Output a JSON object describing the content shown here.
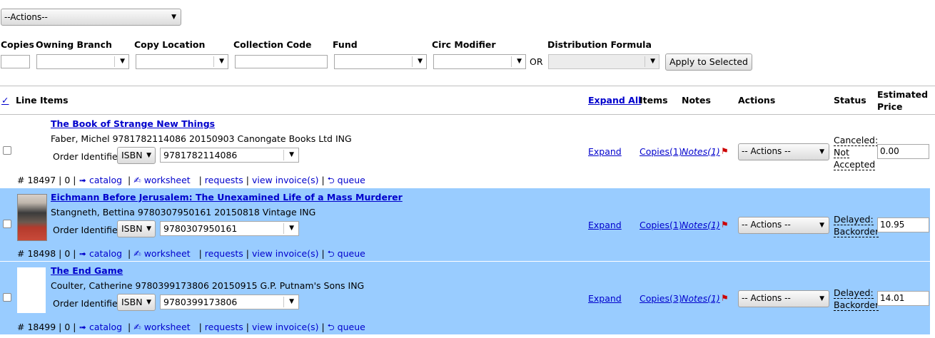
{
  "top": {
    "actions_select": "--Actions--"
  },
  "batch": {
    "copies_label": "Copies",
    "owning_branch_label": "Owning Branch",
    "copy_location_label": "Copy Location",
    "collection_code_label": "Collection Code",
    "fund_label": "Fund",
    "circ_modifier_label": "Circ Modifier",
    "or_text": "OR",
    "distribution_formula_label": "Distribution Formula",
    "apply_button": "Apply to Selected"
  },
  "header": {
    "check_mark": "✓",
    "line_items": "Line Items",
    "expand_all": "Expand All",
    "items": "Items",
    "notes": "Notes",
    "actions": "Actions",
    "status": "Status",
    "estimated": "Estimated",
    "price": "Price"
  },
  "colors": {
    "highlight_row": "#99ccff",
    "link": "#0000cc",
    "flag": "#cc0000"
  },
  "rows": [
    {
      "title": "The Book of Strange New Things",
      "meta": "Faber, Michel 9781782114086 20150903 Canongate Books Ltd ING",
      "order_identifier_label": "Order Identifier",
      "identifier_type": "ISBN",
      "identifier_value": "9781782114086",
      "id_text": "# 18497 | 0 |",
      "catalog": "➟ catalog",
      "worksheet": "✍ worksheet",
      "requests": "requests",
      "view_invoice": "view invoice(s)",
      "queue": "⮌ queue",
      "expand": "Expand",
      "copies": "Copies(1)",
      "notes": "Notes(1)",
      "flag_icon": "flag-icon",
      "actions": "-- Actions --",
      "status_line1": "Canceled:",
      "status_line2": "Not",
      "status_line3": "Accepted",
      "price": "0.00",
      "highlighted": false
    },
    {
      "title": "Eichmann Before Jerusalem: The Unexamined Life of a Mass Murderer",
      "meta": "Stangneth, Bettina 9780307950161 20150818 Vintage ING",
      "order_identifier_label": "Order Identifier",
      "identifier_type": "ISBN",
      "identifier_value": "9780307950161",
      "id_text": "# 18498 | 0 |",
      "catalog": "➟ catalog",
      "worksheet": "✍ worksheet",
      "requests": "requests",
      "view_invoice": "view invoice(s)",
      "queue": "⮌ queue",
      "expand": "Expand",
      "copies": "Copies(1)",
      "notes": "Notes(1)",
      "flag_icon": "flag-icon",
      "actions": "-- Actions --",
      "status_line1": "Delayed:",
      "status_line2": "Backorder",
      "status_line3": "",
      "price": "10.95",
      "highlighted": true
    },
    {
      "title": "The End Game",
      "meta": "Coulter, Catherine 9780399173806 20150915 G.P. Putnam's Sons ING",
      "order_identifier_label": "Order Identifier",
      "identifier_type": "ISBN",
      "identifier_value": "9780399173806",
      "id_text": "# 18499 | 0 |",
      "catalog": "➟ catalog",
      "worksheet": "✍ worksheet",
      "requests": "requests",
      "view_invoice": "view invoice(s)",
      "queue": "⮌ queue",
      "expand": "Expand",
      "copies": "Copies(3)",
      "notes": "Notes(1)",
      "flag_icon": "flag-icon",
      "actions": "-- Actions --",
      "status_line1": "Delayed:",
      "status_line2": "Backorder",
      "status_line3": "",
      "price": "14.01",
      "highlighted": true
    }
  ]
}
